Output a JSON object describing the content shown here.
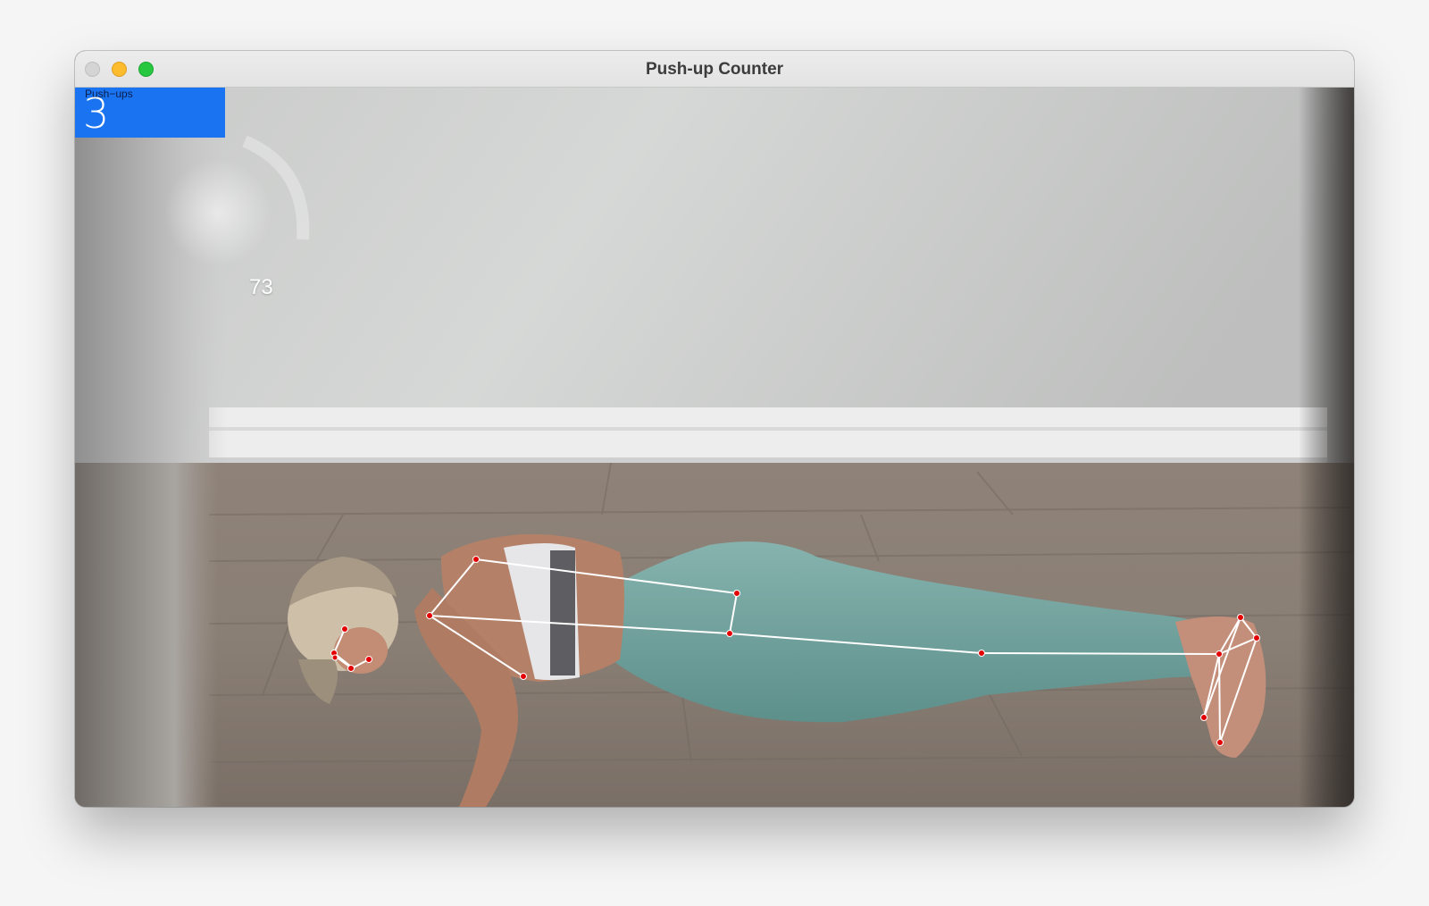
{
  "window": {
    "title": "Push-up Counter"
  },
  "overlay": {
    "counter_label": "Push−ups",
    "counter_value": "3",
    "angle_value": "73"
  },
  "colors": {
    "counter_box": "#1a73f0",
    "skeleton_line": "#ffffff",
    "keypoint": "#e30000",
    "legging": "#6fa3a0"
  }
}
